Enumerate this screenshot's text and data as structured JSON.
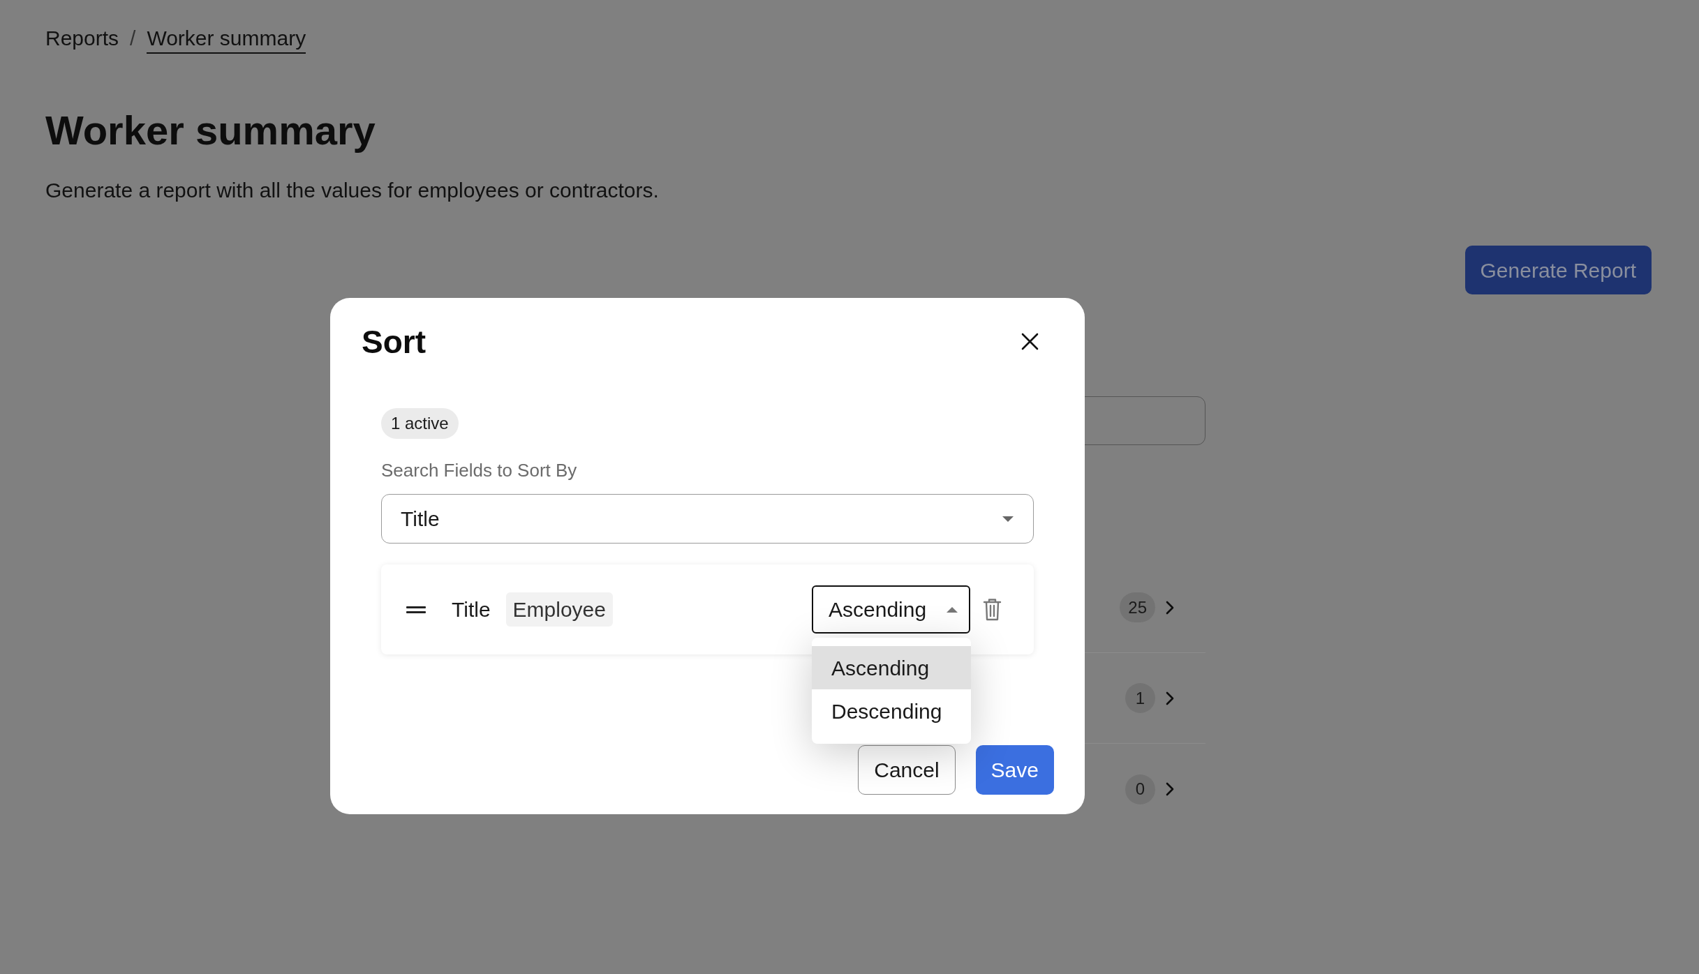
{
  "breadcrumb": {
    "separator": "/",
    "items": [
      {
        "label": "Reports",
        "current": false
      },
      {
        "label": "Worker summary",
        "current": true
      }
    ]
  },
  "page": {
    "title": "Worker summary",
    "description": "Generate a report with all the values for employees or contractors.",
    "generate_button": "Generate Report"
  },
  "list_rows": [
    {
      "count": "25"
    },
    {
      "count": "1"
    },
    {
      "count": "0"
    }
  ],
  "modal": {
    "title": "Sort",
    "active_badge": "1 active",
    "search_label": "Search Fields to Sort By",
    "search_select": {
      "value": "Title"
    },
    "sort_rules": [
      {
        "field": "Title",
        "tag": "Employee",
        "direction": "Ascending",
        "open": true,
        "options": [
          {
            "label": "Ascending",
            "selected": true
          },
          {
            "label": "Descending",
            "selected": false
          }
        ]
      }
    ],
    "buttons": [
      {
        "label": "Cancel",
        "kind": "secondary"
      },
      {
        "label": "Save",
        "kind": "primary"
      }
    ]
  }
}
